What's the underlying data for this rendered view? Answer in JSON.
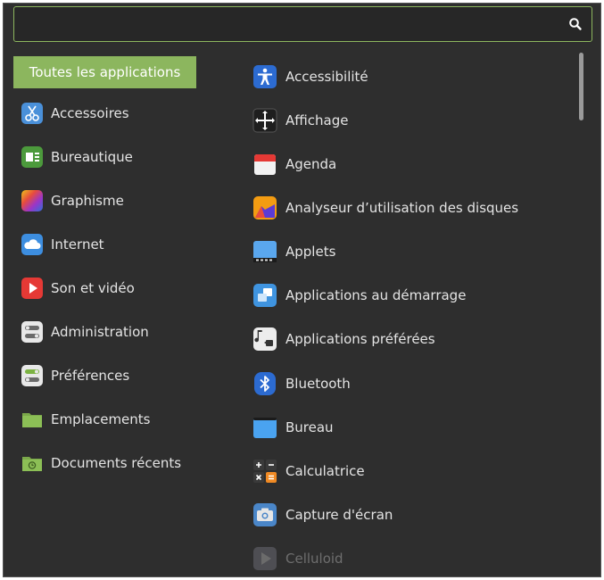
{
  "search": {
    "value": "",
    "placeholder": "",
    "icon": "search-icon"
  },
  "categories": [
    {
      "label": "Toutes les applications",
      "active": true
    },
    {
      "label": "Accessoires",
      "icon": "scissors-icon"
    },
    {
      "label": "Bureautique",
      "icon": "office-icon"
    },
    {
      "label": "Graphisme",
      "icon": "graphics-icon"
    },
    {
      "label": "Internet",
      "icon": "cloud-icon"
    },
    {
      "label": "Son et vidéo",
      "icon": "play-icon"
    },
    {
      "label": "Administration",
      "icon": "toggles-icon"
    },
    {
      "label": "Préférences",
      "icon": "preferences-toggle-icon"
    },
    {
      "label": "Emplacements",
      "icon": "folder-icon"
    },
    {
      "label": "Documents récents",
      "icon": "recent-folder-icon"
    }
  ],
  "apps": [
    {
      "label": "Accessibilité",
      "icon": "accessibility-icon"
    },
    {
      "label": "Affichage",
      "icon": "display-icon"
    },
    {
      "label": "Agenda",
      "icon": "calendar-icon"
    },
    {
      "label": "Analyseur d’utilisation des disques",
      "icon": "disk-usage-icon"
    },
    {
      "label": "Applets",
      "icon": "applets-icon"
    },
    {
      "label": "Applications au démarrage",
      "icon": "startup-apps-icon"
    },
    {
      "label": "Applications préférées",
      "icon": "preferred-apps-icon"
    },
    {
      "label": "Bluetooth",
      "icon": "bluetooth-icon"
    },
    {
      "label": "Bureau",
      "icon": "desktop-icon"
    },
    {
      "label": "Calculatrice",
      "icon": "calculator-icon"
    },
    {
      "label": "Capture d'écran",
      "icon": "camera-icon"
    },
    {
      "label": "Celluloid",
      "icon": "celluloid-icon",
      "dimmed": true
    }
  ],
  "colors": {
    "accent": "#8cb65e",
    "background": "#2e2e2e",
    "text": "#e4e4e4"
  }
}
